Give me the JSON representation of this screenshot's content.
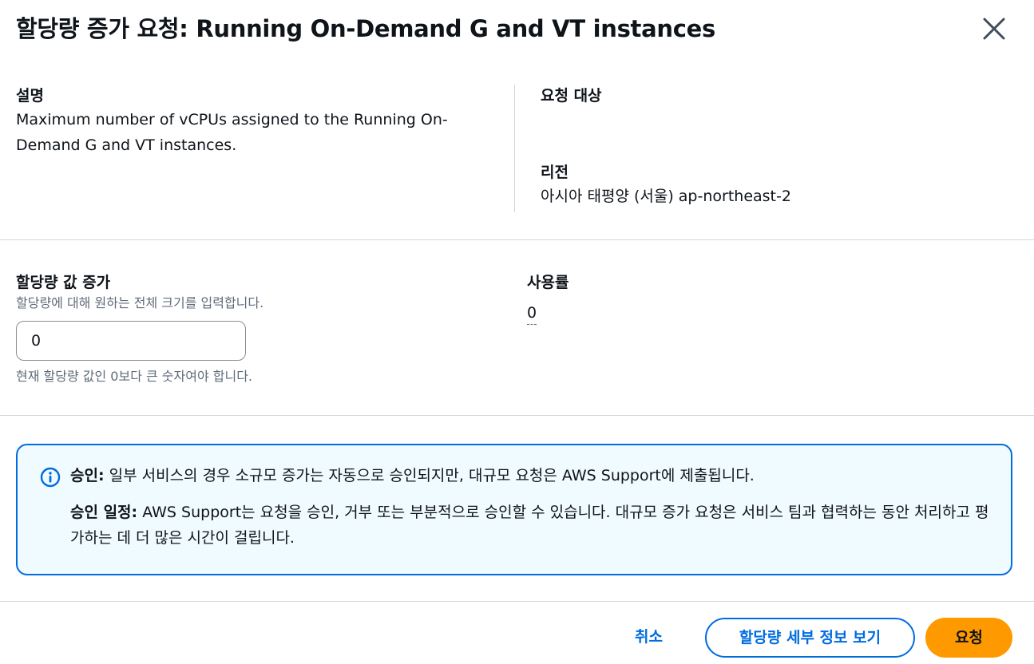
{
  "dialog": {
    "title": "할당량 증가 요청: Running On-Demand G and VT instances",
    "close_icon": "close-icon"
  },
  "details": {
    "description_label": "설명",
    "description_value": "Maximum number of vCPUs assigned to the Running On-Demand G and VT instances.",
    "request_target_label": "요청 대상",
    "request_target_value": "",
    "region_label": "리전",
    "region_value": "아시아 태평양 (서울) ap-northeast-2"
  },
  "quota_form": {
    "label": "할당량 값 증가",
    "hint": "할당량에 대해 원하는 전체 크기를 입력합니다.",
    "input_value": "0",
    "constraint": "현재 할당량 값인 0보다 큰 숫자여야 합니다."
  },
  "usage": {
    "label": "사용률",
    "value": "0"
  },
  "alert": {
    "icon": "info-icon",
    "approval_label": "승인:",
    "approval_text": "일부 서비스의 경우 소규모 증가는 자동으로 승인되지만, 대규모 요청은 AWS Support에 제출됩니다.",
    "schedule_label": "승인 일정:",
    "schedule_text": "AWS Support는 요청을 승인, 거부 또는 부분적으로 승인할 수 있습니다. 대규모 증가 요청은 서비스 팀과 협력하는 동안 처리하고 평가하는 데 더 많은 시간이 걸립니다."
  },
  "footer": {
    "cancel_label": "취소",
    "view_details_label": "할당량 세부 정보 보기",
    "request_label": "요청"
  },
  "colors": {
    "accent": "#006ce0",
    "primary_button": "#ff9900",
    "alert_background": "#f0fbff"
  }
}
